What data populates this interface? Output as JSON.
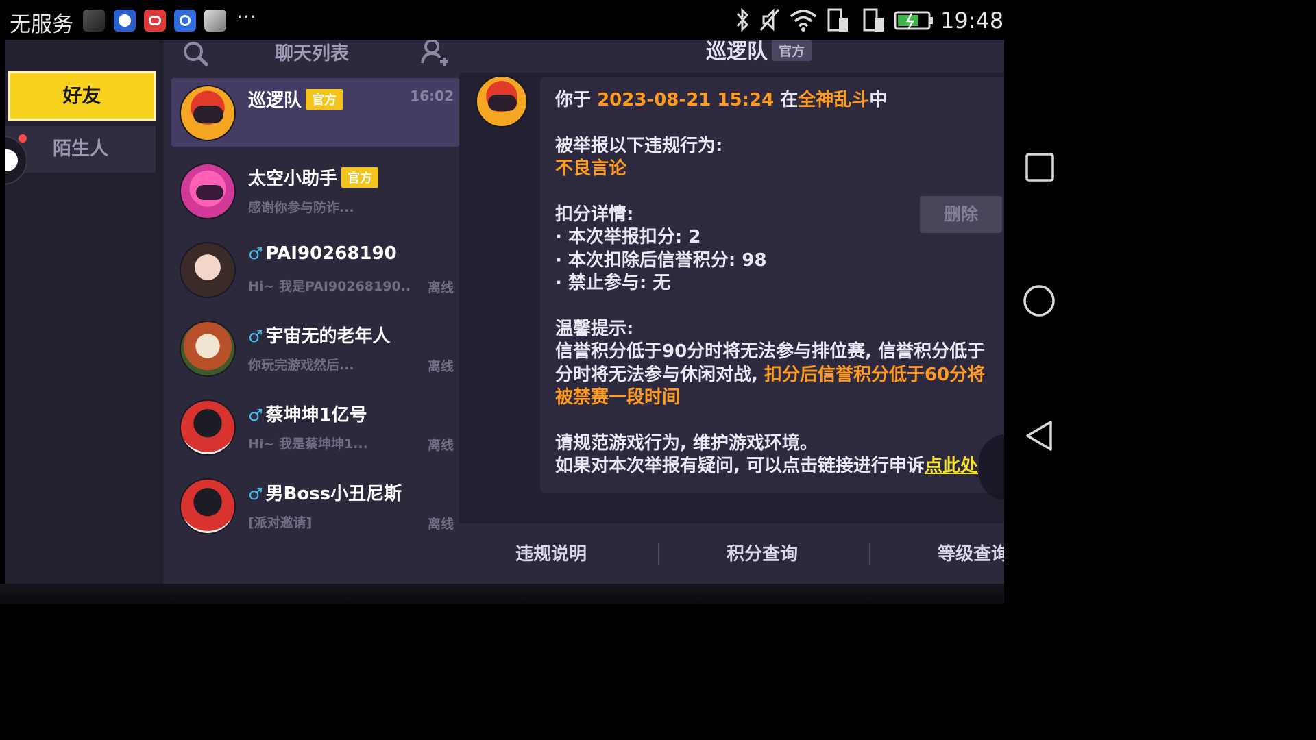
{
  "status_bar": {
    "carrier": "无服务",
    "more": "···",
    "time": "19:48",
    "icons": [
      "bluetooth-icon",
      "vibrate-off-icon",
      "wifi-icon",
      "sim1-icon",
      "sim2-icon",
      "battery-charging-icon"
    ]
  },
  "left_tabs": {
    "friends": "好友",
    "strangers": "陌生人"
  },
  "chat_list": {
    "title": "聊天列表",
    "items": [
      {
        "name": "巡逻队",
        "badge": "官方",
        "time": "16:02",
        "preview": "",
        "status": "",
        "gender": ""
      },
      {
        "name": "太空小助手",
        "badge": "官方",
        "time": "",
        "preview": "感谢你参与防诈...",
        "status": "",
        "gender": ""
      },
      {
        "name": "PAI90268190",
        "badge": "",
        "time": "",
        "preview": "Hi~ 我是PAI90268190..",
        "status": "离线",
        "gender": "♂"
      },
      {
        "name": "宇宙无的老年人",
        "badge": "",
        "time": "",
        "preview": "你玩完游戏然后...",
        "status": "离线",
        "gender": "♂"
      },
      {
        "name": "蔡坤坤1亿号",
        "badge": "",
        "time": "",
        "preview": "Hi~ 我是蔡坤坤1...",
        "status": "离线",
        "gender": "♂"
      },
      {
        "name": "男Boss小丑尼斯",
        "badge": "",
        "time": "",
        "preview": "[派对邀请]",
        "status": "离线",
        "gender": "♂"
      }
    ]
  },
  "chat_panel": {
    "title": "巡逻队",
    "title_badge": "官方",
    "message": {
      "l1_a": "你于 ",
      "l1_date": "2023-08-21 15:24",
      "l1_b": " 在",
      "l1_game": "全神乱斗",
      "l1_c": "中",
      "l2": "被举报以下违规行为:",
      "l3": "不良言论",
      "l4": "扣分详情:",
      "l5": "· 本次举报扣分: 2",
      "l6": "· 本次扣除后信誉积分: 98",
      "l7": "· 禁止参与: 无",
      "l8": "温馨提示:",
      "l9": "信誉积分低于90分时将无法参与排位赛, 信誉积分低于",
      "l10_a": "分时将无法参与休闲对战, ",
      "l10_b": "扣分后信誉积分低于60分将",
      "l11": "被禁赛一段时间",
      "l12": "请规范游戏行为, 维护游戏环境。",
      "l13_a": "如果对本次举报有疑问, 可以点击链接进行申诉",
      "l13_link": "点此处"
    },
    "delete_label": "删除",
    "footer": [
      "违规说明",
      "积分查询",
      "等级查询"
    ]
  },
  "colors": {
    "highlight": "#ff9a1e",
    "official_badge": "#f4c41d",
    "friends_tab": "#f8d21e",
    "background": "#272538"
  }
}
